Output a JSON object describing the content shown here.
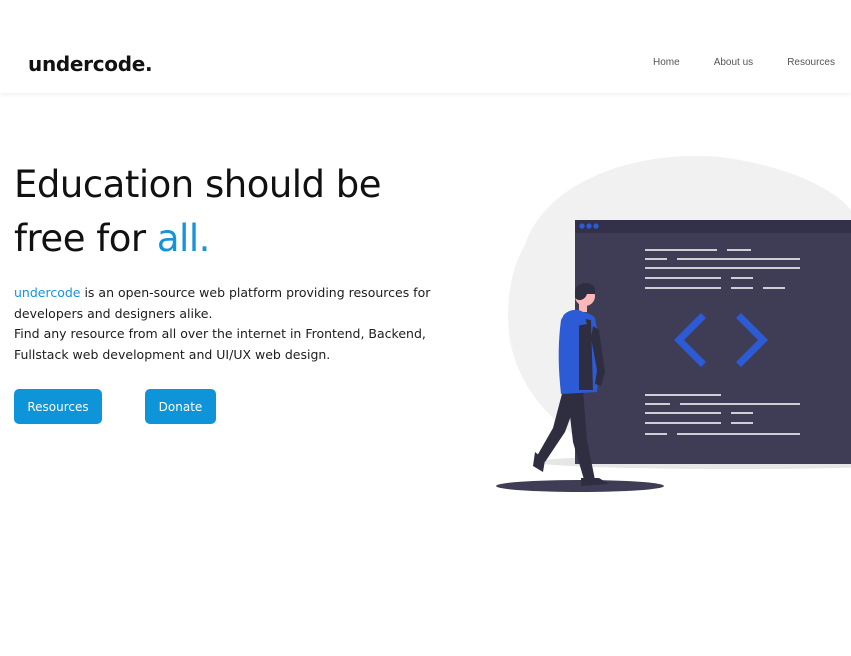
{
  "header": {
    "logo": "undercode.",
    "nav": [
      "Home",
      "About us",
      "Resources"
    ]
  },
  "hero": {
    "title_line1": "Education should be",
    "title_line2_prefix": "free for ",
    "title_line2_accent": "all.",
    "desc_brand": "undercode",
    "desc_part1": " is an open-source web platform providing resources for developers and designers alike.",
    "desc_part2": "Find any resource from all over the internet in Frontend, Backend, Fullstack web development and UI/UX web design.",
    "button_resources": "Resources",
    "button_donate": "Donate"
  },
  "colors": {
    "accent": "#1793d8",
    "button": "#0d94d9",
    "illustration_dark": "#3f3d56",
    "illustration_blue": "#2d5bd6"
  },
  "illustration": {
    "icon": "code-brackets-icon",
    "figure": "person-walking"
  }
}
